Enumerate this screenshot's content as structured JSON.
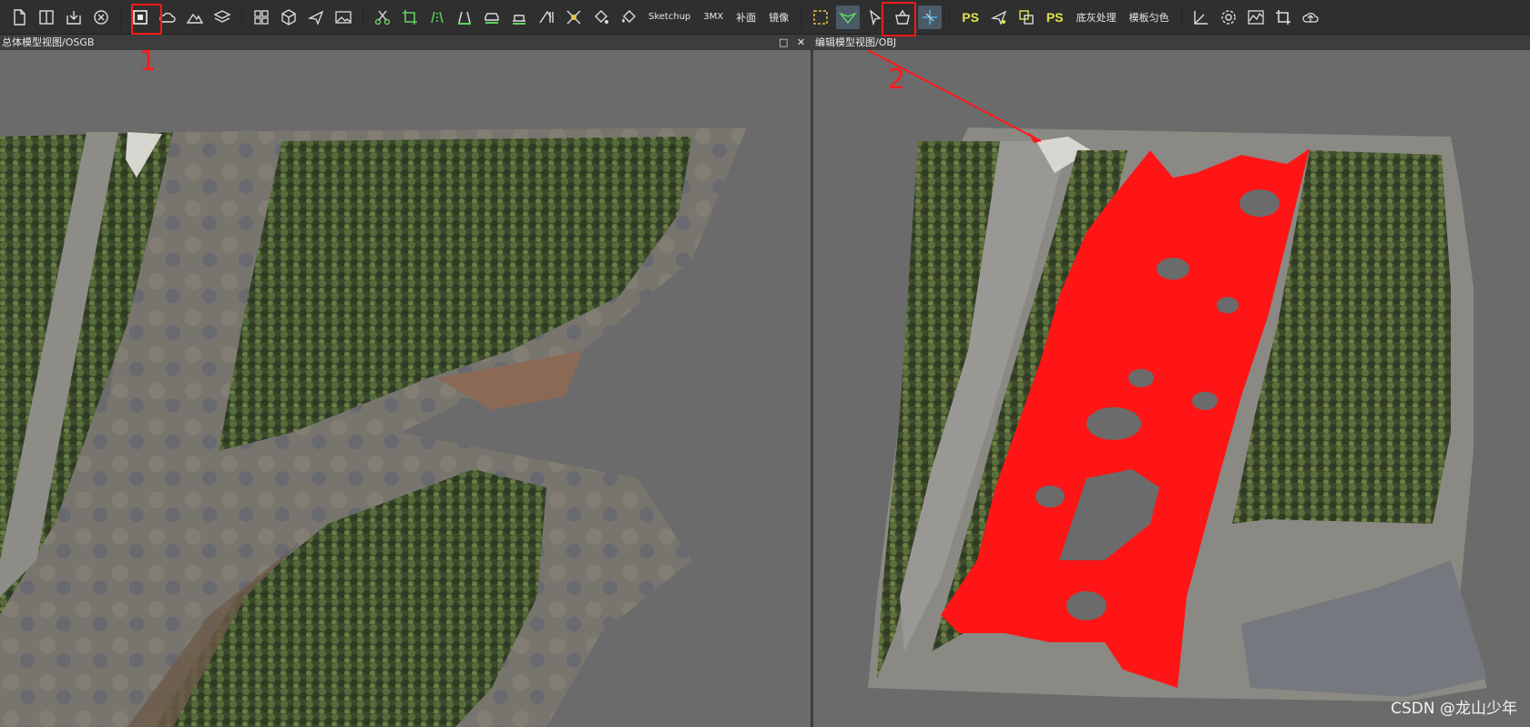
{
  "toolbar": {
    "text_buttons": {
      "sketchup": "Sketchup",
      "3mx": "3MX",
      "patch": "补面",
      "mirror": "镜像",
      "base_process": "底灰处理",
      "template_color": "模板匀色"
    },
    "ps_label": "PS"
  },
  "left_panel": {
    "title": "总体模型视图/OSGB",
    "restore": "□",
    "close": "✕"
  },
  "right_panel": {
    "title": "编辑模型视图/OBJ"
  },
  "annotations": {
    "label_1": "1",
    "label_2": "2",
    "color": "#ff1a1a"
  },
  "watermark": "CSDN @龙山少年",
  "colors": {
    "highlight_mesh": "#ff1515",
    "background": "#6b6b6b",
    "toolbar": "#2f2f2f"
  }
}
